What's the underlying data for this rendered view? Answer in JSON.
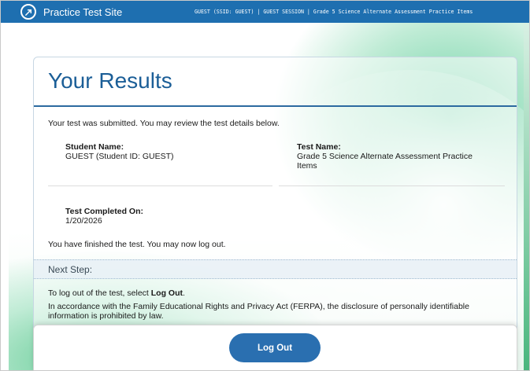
{
  "header": {
    "site_title": "Practice Test Site",
    "session_info": "GUEST (SSID: GUEST) | GUEST SESSION | Grade 5 Science Alternate Assessment Practice Items"
  },
  "results": {
    "title": "Your Results",
    "intro": "Your test was submitted. You may review the test details below.",
    "student_name_label": "Student Name:",
    "student_name_value": "GUEST (Student ID: GUEST)",
    "test_name_label": "Test Name:",
    "test_name_value": "Grade 5 Science Alternate Assessment Practice Items",
    "completed_label": "Test Completed On:",
    "completed_value": "1/20/2026",
    "finished_message": "You have finished the test. You may now log out."
  },
  "next_step": {
    "heading": "Next Step:",
    "instruction_prefix": "To log out of the test, select ",
    "instruction_bold": "Log Out",
    "instruction_suffix": ".",
    "ferpa_notice": "In accordance with the Family Educational Rights and Privacy Act (FERPA), the disclosure of personally identifiable information is prohibited by law."
  },
  "footer": {
    "logout_label": "Log Out"
  },
  "icons": {
    "logo": "practice-test-logo-icon"
  },
  "colors": {
    "header_bar": "#1e6fb0",
    "title_blue": "#1b5e97",
    "button_blue": "#2a6fb0",
    "accent_green": "#5cc890"
  }
}
